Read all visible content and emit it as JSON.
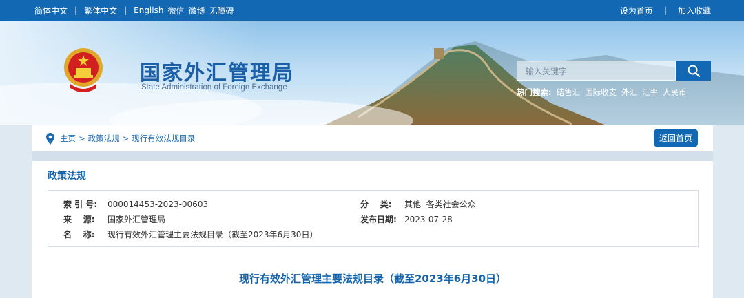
{
  "topbar": {
    "left_links": [
      "简体中文",
      "繁体中文",
      "English",
      "微信",
      "微博",
      "无障碍"
    ],
    "right_links": [
      "设为首页",
      "加入收藏"
    ]
  },
  "header": {
    "title_cn": "国家外汇管理局",
    "title_en": "State Administration of Foreign Exchange",
    "search_placeholder": "输入关键字",
    "hot_label": "热门搜索:",
    "hot_terms": [
      "结售汇",
      "国际收支",
      "外汇",
      "汇率",
      "人民币"
    ]
  },
  "breadcrumb": {
    "home": "主页",
    "sep": ">",
    "level1": "政策法规",
    "level2": "现行有效法规目录",
    "back_label": "返回首页"
  },
  "section": {
    "title": "政策法规"
  },
  "info": {
    "index_label": "索 引 号:",
    "index_value": "000014453-2023-00603",
    "source_label": "来    源:",
    "source_value": "国家外汇管理局",
    "name_label": "名    称:",
    "name_value": "现行有效外汇管理主要法规目录（截至2023年6月30日）",
    "category_label": "分    类:",
    "category_value": "其他  各类社会公众",
    "date_label": "发布日期:",
    "date_value": "2023-07-28"
  },
  "document": {
    "title": "现行有效外汇管理主要法规目录（截至2023年6月30日）"
  },
  "colors": {
    "brand_blue": "#1368b3",
    "link_blue": "#1c6db4",
    "heading_blue": "#1363ad"
  },
  "icons": [
    "map-pin-icon",
    "search-icon",
    "national-emblem"
  ]
}
